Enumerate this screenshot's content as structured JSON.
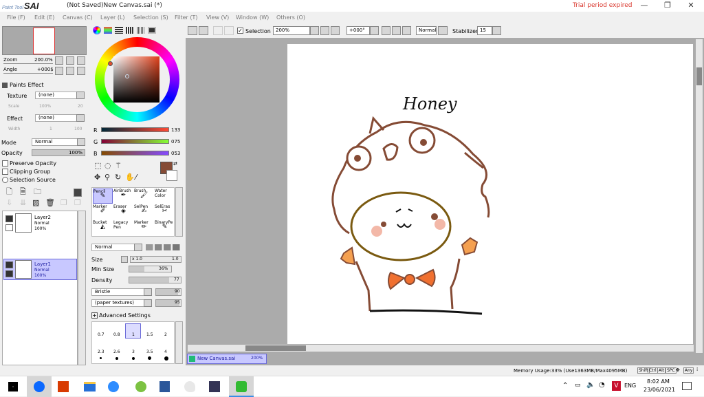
{
  "app": {
    "logo_small": "Paint Tool",
    "logo_big": "SAI",
    "title": "(Not Saved)New Canvas.sai (*)",
    "trial": "Trial period expired"
  },
  "menu": [
    "File (F)",
    "Edit (E)",
    "Canvas (C)",
    "Layer (L)",
    "Selection (S)",
    "Filter (T)",
    "View (V)",
    "Window (W)",
    "Others (O)"
  ],
  "navigator": {
    "zoom_label": "Zoom",
    "zoom_value": "200.0%",
    "angle_label": "Angle",
    "angle_value": "+000$"
  },
  "paints_effect": {
    "header": "Paints Effect",
    "texture_label": "Texture",
    "texture_value": "(none)",
    "scale_label": "Scale",
    "scale_value": "100%",
    "scale_num": "20",
    "effect_label": "Effect",
    "effect_value": "(none)",
    "width_label": "Width",
    "width_value": "1",
    "width_num": "100"
  },
  "layer_props": {
    "mode_label": "Mode",
    "mode_value": "Normal",
    "opacity_label": "Opacity",
    "opacity_value": "100%",
    "preserve_opacity": "Preserve Opacity",
    "clipping_group": "Clipping Group",
    "selection_source": "Selection Source"
  },
  "layers": [
    {
      "name": "Layer2",
      "mode": "Normal",
      "opacity": "100%"
    },
    {
      "name": "Layer1",
      "mode": "Normal",
      "opacity": "100%"
    }
  ],
  "color": {
    "r_label": "R",
    "r_value": "133",
    "g_label": "G",
    "g_value": "075",
    "b_label": "B",
    "b_value": "053",
    "current": "#854b35"
  },
  "tools": [
    {
      "name": "Pencil"
    },
    {
      "name": "AirBrush"
    },
    {
      "name": "Brush"
    },
    {
      "name": "Water Color"
    },
    {
      "name": "Marker"
    },
    {
      "name": "Eraser"
    },
    {
      "name": "SelPen"
    },
    {
      "name": "SelEras"
    },
    {
      "name": "Bucket"
    },
    {
      "name": "Legacy Pen"
    },
    {
      "name": "Marker"
    },
    {
      "name": "BinaryPe"
    }
  ],
  "brush": {
    "blend_mode": "Normal",
    "size_label": "Size",
    "size_mult": "x 1.0",
    "size_value": "1.0",
    "min_size_label": "Min Size",
    "min_size_value": "36%",
    "min_size_fraction": 0.36,
    "density_label": "Density",
    "density_value": "77",
    "density_fraction": 0.77,
    "shape": "Bristle",
    "shape_value": "90",
    "texture": "(paper textures)",
    "texture_value": "95",
    "advanced": "Advanced Settings",
    "sizes_row1": [
      "0.7",
      "0.8",
      "1",
      "1.5",
      "2"
    ],
    "sizes_row2": [
      "2.3",
      "2.6",
      "3",
      "3.5",
      "4"
    ]
  },
  "toolbar": {
    "selection_label": "Selection",
    "zoom": "200%",
    "angle": "+000°",
    "mode": "Normal",
    "stabilizer_label": "Stabilizer",
    "stabilizer": "15"
  },
  "canvas": {
    "handwriting": "Honey",
    "tab_name": "New Canvas.sai",
    "tab_zoom": "200%",
    "colors": {
      "brown": "#854b35",
      "olive": "#7a5a10",
      "orange": "#f07030",
      "hands": "#f5a050",
      "blush": "#f3b8a8"
    }
  },
  "status": {
    "memory": "Memory Usage:33% (Use1363MB/Max4095MB)",
    "keys": [
      "Shift",
      "Ctrl",
      "Alt",
      "SPC",
      "Any"
    ]
  },
  "taskbar": {
    "time": "8:02 AM",
    "date": "23/06/2021",
    "lang": "ENG",
    "apps": [
      "zalo",
      "office",
      "folder",
      "zoom",
      "chrome-like",
      "word",
      "paint",
      "photo",
      "sai"
    ]
  }
}
